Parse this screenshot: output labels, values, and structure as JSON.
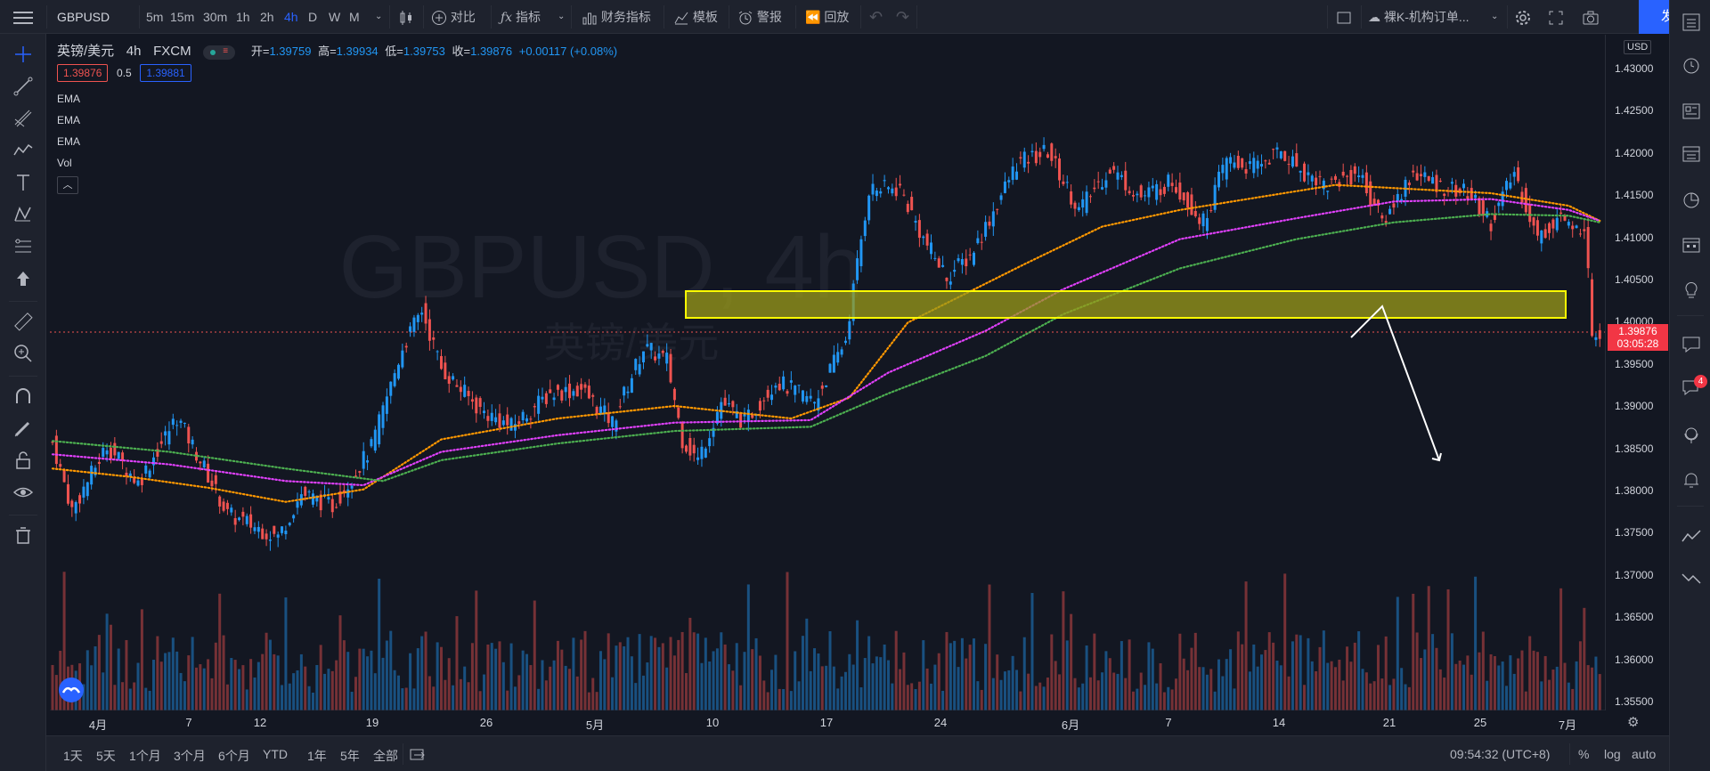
{
  "topbar": {
    "symbol": "GBPUSD",
    "intervals": [
      "5m",
      "15m",
      "30m",
      "1h",
      "2h",
      "4h",
      "D",
      "W",
      "M"
    ],
    "active_interval": "4h",
    "compare": "对比",
    "indicators": "指标",
    "financials": "财务指标",
    "templates": "模板",
    "alerts": "警报",
    "replay": "回放",
    "layout_name": "裸K-机构订单...",
    "publish": "发表"
  },
  "legend": {
    "symbol_name": "英镑/美元",
    "interval": "4h",
    "exchange": "FXCM",
    "open_label": "开=",
    "open": "1.39759",
    "high_label": "高=",
    "high": "1.39934",
    "low_label": "低=",
    "low": "1.39753",
    "close_label": "收=",
    "close": "1.39876",
    "change": "+0.00117 (+0.08%)",
    "bid": "1.39876",
    "spread": "0.5",
    "ask": "1.39881",
    "indicators": [
      "EMA",
      "EMA",
      "EMA",
      "Vol"
    ]
  },
  "watermark": {
    "line1": "GBPUSD, 4h",
    "line2": "英镑/美元"
  },
  "price_axis": {
    "currency": "USD",
    "ticks": [
      "1.43000",
      "1.42500",
      "1.42000",
      "1.41500",
      "1.41000",
      "1.40500",
      "1.40000",
      "1.39500",
      "1.39000",
      "1.38500",
      "1.38000",
      "1.37500",
      "1.37000",
      "1.36500",
      "1.36000",
      "1.35500"
    ],
    "current_price": "1.39876",
    "countdown": "03:05:28"
  },
  "time_axis": {
    "labels": [
      "4月",
      "7",
      "12",
      "19",
      "26",
      "5月",
      "10",
      "17",
      "24",
      "6月",
      "7",
      "14",
      "21",
      "25",
      "7月"
    ]
  },
  "bottombar": {
    "ranges": [
      "1天",
      "5天",
      "1个月",
      "3个月",
      "6个月",
      "YTD",
      "1年",
      "5年",
      "全部"
    ],
    "clock": "09:54:32 (UTC+8)",
    "percent": "%",
    "log": "log",
    "auto": "auto"
  },
  "badge_count": "4",
  "colors": {
    "up": "#2196f3",
    "down": "#ef5350",
    "ema_fast": "#ff9800",
    "ema_mid": "#e040fb",
    "ema_slow": "#4caf50",
    "zone_fill": "#9b9b1a",
    "zone_border": "#ffff00",
    "accent": "#2962ff"
  },
  "chart_data": {
    "type": "candlestick",
    "symbol": "GBPUSD",
    "interval": "4h",
    "ylim": [
      1.3525,
      1.4335
    ],
    "anchors": [
      [
        0,
        1.3846
      ],
      [
        5,
        1.3765
      ],
      [
        14,
        1.3843
      ],
      [
        22,
        1.3798
      ],
      [
        32,
        1.3877
      ],
      [
        38,
        1.3825
      ],
      [
        45,
        1.376
      ],
      [
        58,
        1.3733
      ],
      [
        64,
        1.3785
      ],
      [
        72,
        1.377
      ],
      [
        82,
        1.384
      ],
      [
        90,
        1.396
      ],
      [
        95,
        1.4005
      ],
      [
        100,
        1.3935
      ],
      [
        110,
        1.3885
      ],
      [
        118,
        1.3865
      ],
      [
        128,
        1.3905
      ],
      [
        136,
        1.391
      ],
      [
        144,
        1.387
      ],
      [
        152,
        1.396
      ],
      [
        158,
        1.3945
      ],
      [
        162,
        1.385
      ],
      [
        166,
        1.3825
      ],
      [
        172,
        1.3895
      ],
      [
        178,
        1.387
      ],
      [
        186,
        1.392
      ],
      [
        196,
        1.3895
      ],
      [
        204,
        1.397
      ],
      [
        210,
        1.415
      ],
      [
        218,
        1.415
      ],
      [
        224,
        1.409
      ],
      [
        230,
        1.4045
      ],
      [
        236,
        1.407
      ],
      [
        240,
        1.4105
      ],
      [
        248,
        1.418
      ],
      [
        256,
        1.4195
      ],
      [
        264,
        1.4125
      ],
      [
        272,
        1.4175
      ],
      [
        280,
        1.414
      ],
      [
        288,
        1.416
      ],
      [
        296,
        1.411
      ],
      [
        302,
        1.4185
      ],
      [
        308,
        1.4175
      ],
      [
        316,
        1.4195
      ],
      [
        322,
        1.417
      ],
      [
        328,
        1.4155
      ],
      [
        336,
        1.417
      ],
      [
        342,
        1.411
      ],
      [
        350,
        1.417
      ],
      [
        356,
        1.4155
      ],
      [
        364,
        1.4145
      ],
      [
        370,
        1.411
      ],
      [
        376,
        1.417
      ],
      [
        382,
        1.409
      ],
      [
        388,
        1.412
      ],
      [
        391,
        1.4095
      ],
      [
        394,
        1.411
      ],
      [
        396,
        1.398
      ]
    ],
    "ema": [
      {
        "color": "#ff9800",
        "points": [
          [
            0,
            1.3815
          ],
          [
            20,
            1.3805
          ],
          [
            40,
            1.3792
          ],
          [
            60,
            1.3775
          ],
          [
            80,
            1.379
          ],
          [
            100,
            1.385
          ],
          [
            130,
            1.3875
          ],
          [
            160,
            1.389
          ],
          [
            190,
            1.3875
          ],
          [
            205,
            1.39
          ],
          [
            220,
            1.399
          ],
          [
            250,
            1.406
          ],
          [
            270,
            1.4105
          ],
          [
            290,
            1.4125
          ],
          [
            310,
            1.414
          ],
          [
            330,
            1.4155
          ],
          [
            350,
            1.415
          ],
          [
            370,
            1.4145
          ],
          [
            390,
            1.413
          ],
          [
            398,
            1.4112
          ]
        ]
      },
      {
        "color": "#e040fb",
        "points": [
          [
            0,
            1.3832
          ],
          [
            30,
            1.382
          ],
          [
            60,
            1.38
          ],
          [
            80,
            1.3795
          ],
          [
            100,
            1.3835
          ],
          [
            130,
            1.3855
          ],
          [
            160,
            1.387
          ],
          [
            195,
            1.3873
          ],
          [
            215,
            1.393
          ],
          [
            240,
            1.398
          ],
          [
            260,
            1.403
          ],
          [
            290,
            1.409
          ],
          [
            320,
            1.4115
          ],
          [
            345,
            1.4135
          ],
          [
            370,
            1.4138
          ],
          [
            390,
            1.4125
          ],
          [
            398,
            1.4112
          ]
        ]
      },
      {
        "color": "#4caf50",
        "points": [
          [
            0,
            1.3848
          ],
          [
            30,
            1.3835
          ],
          [
            60,
            1.3815
          ],
          [
            85,
            1.38
          ],
          [
            100,
            1.3825
          ],
          [
            130,
            1.3845
          ],
          [
            160,
            1.386
          ],
          [
            195,
            1.3865
          ],
          [
            215,
            1.3905
          ],
          [
            240,
            1.395
          ],
          [
            260,
            1.4
          ],
          [
            290,
            1.4055
          ],
          [
            320,
            1.409
          ],
          [
            345,
            1.411
          ],
          [
            370,
            1.412
          ],
          [
            390,
            1.4118
          ],
          [
            398,
            1.411
          ]
        ]
      }
    ],
    "zone": {
      "x_start": 200,
      "x_end": 490,
      "y_top": 1.4035,
      "y_bottom": 1.4003
    },
    "projection": [
      [
        402,
        1.3992
      ],
      [
        412,
        1.402
      ],
      [
        432,
        1.3865
      ]
    ],
    "current_price": 1.39876,
    "count": 400
  }
}
